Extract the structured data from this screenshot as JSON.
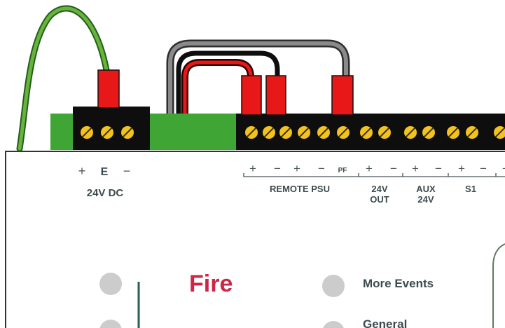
{
  "colors": {
    "terminal_block": "#0e0e0e",
    "screw": "#f2c21f",
    "green_pcb": "#3fa535",
    "red_plug": "#e81818",
    "earth_wire": "#6ab33b",
    "grey_wire": "#8a8a8a",
    "led": "#cccccc",
    "fire_text": "#cf2647",
    "label_text": "#3d4a4d"
  },
  "left_terminal": {
    "polarity": [
      "+",
      "E",
      "−"
    ],
    "label": "24V DC"
  },
  "right_terminal": {
    "groups": [
      {
        "id": "remote-psu",
        "symbols": [
          "+",
          "−",
          "+",
          "−",
          "PF"
        ],
        "label": [
          "REMOTE PSU"
        ]
      },
      {
        "id": "24v-out",
        "symbols": [
          "+",
          "−"
        ],
        "label": [
          "24V",
          "OUT"
        ]
      },
      {
        "id": "aux-24v",
        "symbols": [
          "+",
          "−"
        ],
        "label": [
          "AUX",
          "24V"
        ]
      },
      {
        "id": "s1",
        "symbols": [
          "+",
          "−"
        ],
        "label": [
          "S1"
        ]
      },
      {
        "id": "s2",
        "symbols": [
          "+"
        ],
        "label": []
      }
    ]
  },
  "panel": {
    "title": "Fire",
    "indicators": [
      {
        "id": "more-events",
        "label": "More Events"
      },
      {
        "id": "general",
        "label": "General"
      }
    ]
  },
  "wires": [
    "earth",
    "grey",
    "black",
    "red"
  ]
}
